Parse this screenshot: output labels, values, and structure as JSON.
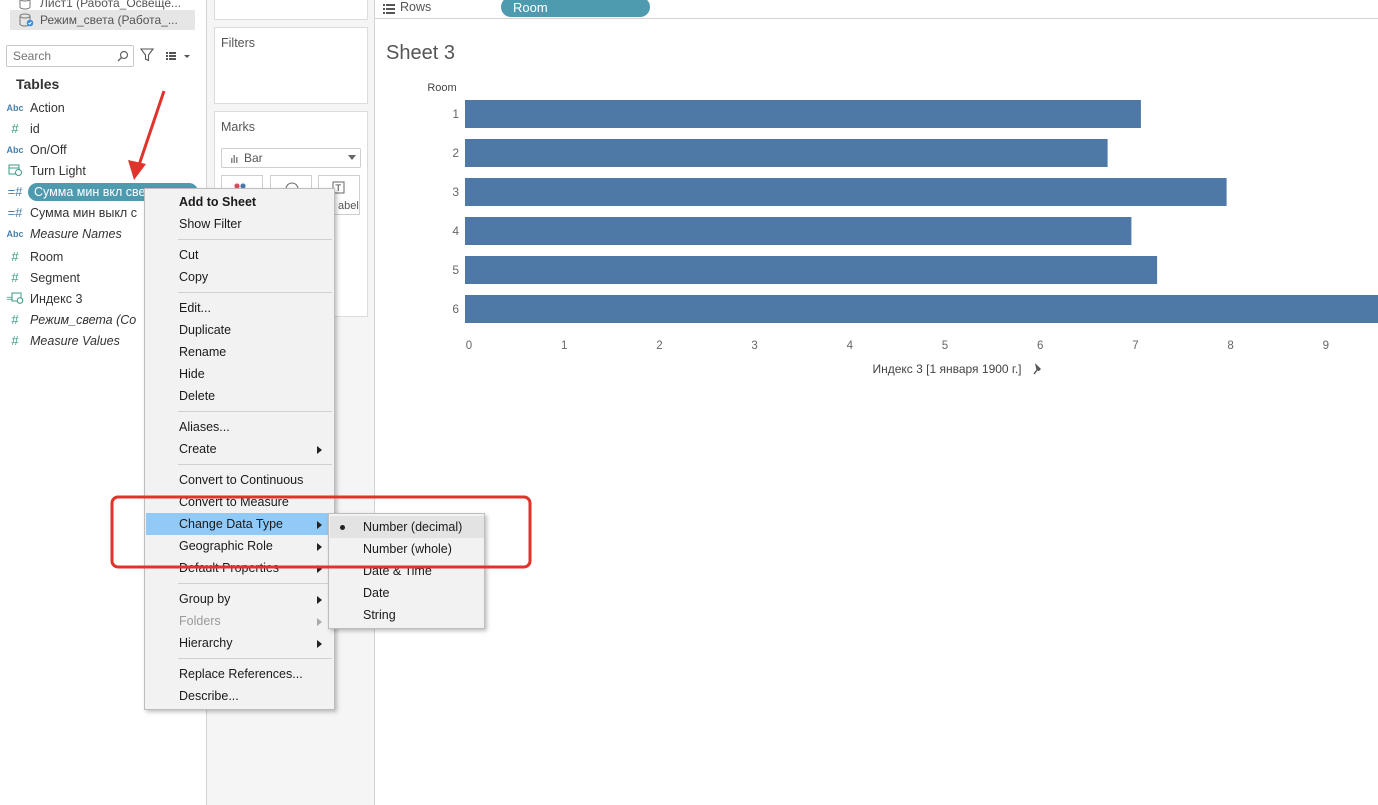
{
  "datasources": [
    {
      "label": "Лист1 (Работа_Освеще...",
      "selected": false
    },
    {
      "label": "Режим_света (Работа_...",
      "selected": true
    }
  ],
  "search": {
    "placeholder": "Search"
  },
  "tables_heading": "Tables",
  "fields": [
    {
      "type": "Abc",
      "label": "Action",
      "italic": false
    },
    {
      "type": "#",
      "label": "id",
      "italic": false
    },
    {
      "type": "Abc",
      "label": "On/Off",
      "italic": false
    },
    {
      "type": "calendar",
      "label": "Turn Light",
      "italic": false
    },
    {
      "type": "=#",
      "label": "Сумма мин вкл све",
      "italic": false,
      "selected": true
    },
    {
      "type": "=#",
      "label": "Сумма мин выкл с",
      "italic": false
    },
    {
      "type": "Abc",
      "label": "Measure Names",
      "italic": true
    },
    {
      "type": "#",
      "label": "Room",
      "italic": false
    },
    {
      "type": "#",
      "label": "Segment",
      "italic": false
    },
    {
      "type": "=calendar",
      "label": "Индекс 3",
      "italic": false
    },
    {
      "type": "#",
      "label": "Режим_света (Со",
      "italic": true
    },
    {
      "type": "#",
      "label": "Measure Values",
      "italic": true
    }
  ],
  "shelves": {
    "filters_title": "Filters",
    "marks_title": "Marks",
    "marks_type": "Bar",
    "label_button": "abel",
    "rows_label": "Rows",
    "rows_pill": "Room"
  },
  "sheet_title": "Sheet 3",
  "chart_data": {
    "type": "bar",
    "orientation": "horizontal",
    "y_header": "Room",
    "categories": [
      "1",
      "2",
      "3",
      "4",
      "5",
      "6"
    ],
    "values": [
      7.1,
      6.75,
      8.0,
      7.0,
      7.27,
      9.65
    ],
    "x_ticks": [
      0,
      1,
      2,
      3,
      4,
      5,
      6,
      7,
      8,
      9
    ],
    "xlim": [
      0,
      9.6
    ],
    "xlabel": "Индекс 3 [1 января 1900 г.]",
    "bar_color": "#4e79a7",
    "grid": false
  },
  "context_menu": {
    "items": [
      {
        "label": "Add to Sheet",
        "bold": true
      },
      {
        "label": "Show Filter"
      },
      {
        "sep": true
      },
      {
        "label": "Cut"
      },
      {
        "label": "Copy"
      },
      {
        "sep": true
      },
      {
        "label": "Edit..."
      },
      {
        "label": "Duplicate"
      },
      {
        "label": "Rename"
      },
      {
        "label": "Hide"
      },
      {
        "label": "Delete"
      },
      {
        "sep": true
      },
      {
        "label": "Aliases..."
      },
      {
        "label": "Create",
        "submenu": true
      },
      {
        "sep": true
      },
      {
        "label": "Convert to Continuous"
      },
      {
        "label": "Convert to Measure"
      },
      {
        "label": "Change Data Type",
        "submenu": true,
        "highlighted": true
      },
      {
        "label": "Geographic Role",
        "submenu": true
      },
      {
        "label": "Default Properties",
        "submenu": true
      },
      {
        "sep": true
      },
      {
        "label": "Group by",
        "submenu": true
      },
      {
        "label": "Folders",
        "submenu": true,
        "disabled": true
      },
      {
        "label": "Hierarchy",
        "submenu": true
      },
      {
        "sep": true
      },
      {
        "label": "Replace References..."
      },
      {
        "label": "Describe..."
      }
    ]
  },
  "data_type_submenu": {
    "items": [
      {
        "label": "Number (decimal)",
        "checked": true
      },
      {
        "label": "Number (whole)"
      },
      {
        "label": "Date & Time"
      },
      {
        "label": "Date"
      },
      {
        "label": "String"
      }
    ]
  },
  "colors": {
    "pill": "#4e9bb0",
    "bar": "#4e79a7",
    "menu_highlight": "#91c9f7",
    "annotation_red": "#e0332b"
  }
}
